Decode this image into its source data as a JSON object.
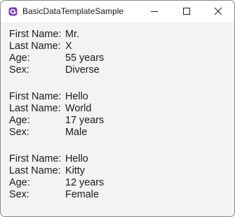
{
  "window": {
    "title": "BasicDataTemplateSample"
  },
  "labels": {
    "first_name": "First Name:",
    "last_name": "Last Name:",
    "age": "Age:",
    "sex": "Sex:"
  },
  "people": [
    {
      "first_name": "Mr.",
      "last_name": "X",
      "age": "55 years",
      "sex": "Diverse"
    },
    {
      "first_name": "Hello",
      "last_name": "World",
      "age": "17 years",
      "sex": "Male"
    },
    {
      "first_name": "Hello",
      "last_name": "Kitty",
      "age": "12 years",
      "sex": "Female"
    }
  ],
  "icons": {
    "app": "app-logo-icon",
    "minimize": "minimize-icon",
    "maximize": "maximize-icon",
    "close": "close-icon"
  },
  "colors": {
    "app_icon": "#7a3fbf",
    "titlebar": "#ffffff",
    "client_background": "#f3f3f3",
    "text": "#1a1a1a"
  }
}
